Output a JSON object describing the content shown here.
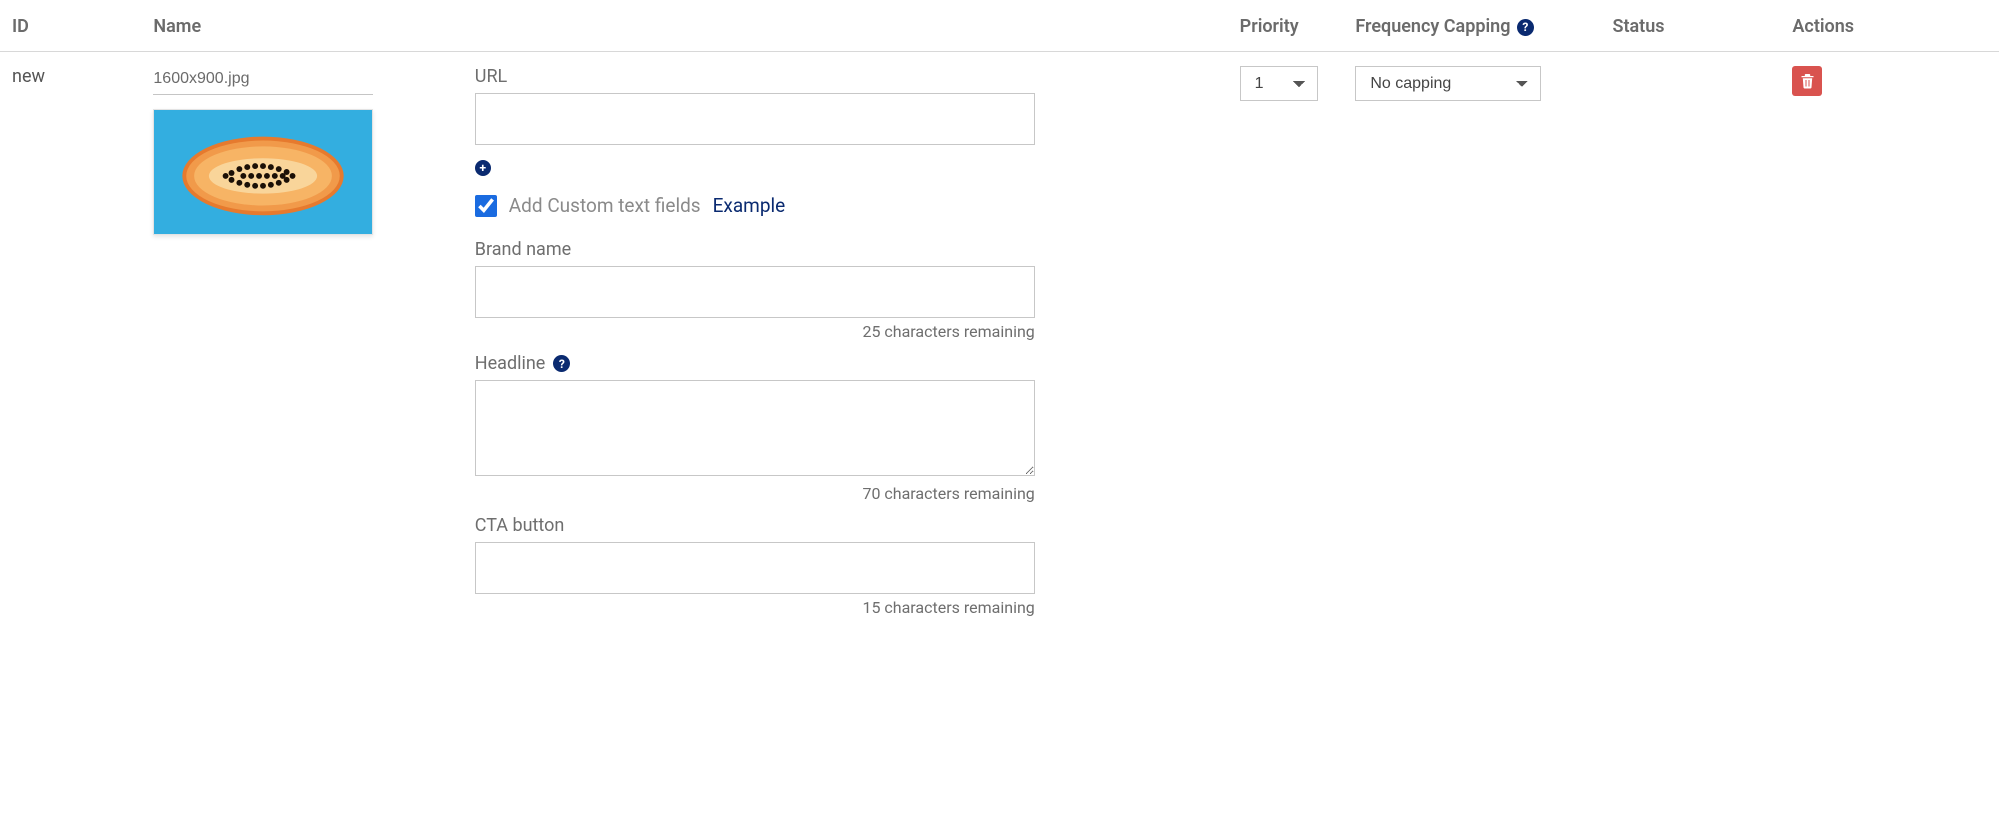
{
  "columns": {
    "id": "ID",
    "name": "Name",
    "priority": "Priority",
    "frequency": "Frequency Capping",
    "status": "Status",
    "actions": "Actions"
  },
  "row": {
    "id": "new",
    "name_value": "1600x900.jpg",
    "priority_selected": "1",
    "frequency_selected": "No capping"
  },
  "form": {
    "url_label": "URL",
    "url_value": "",
    "custom_checkbox_label": "Add Custom text fields",
    "custom_checked": true,
    "example_link": "Example",
    "brand": {
      "label": "Brand name",
      "value": "",
      "remaining": "25 characters remaining"
    },
    "headline": {
      "label": "Headline",
      "value": "",
      "remaining": "70 characters remaining"
    },
    "cta": {
      "label": "CTA button",
      "value": "",
      "remaining": "15 characters remaining"
    }
  }
}
